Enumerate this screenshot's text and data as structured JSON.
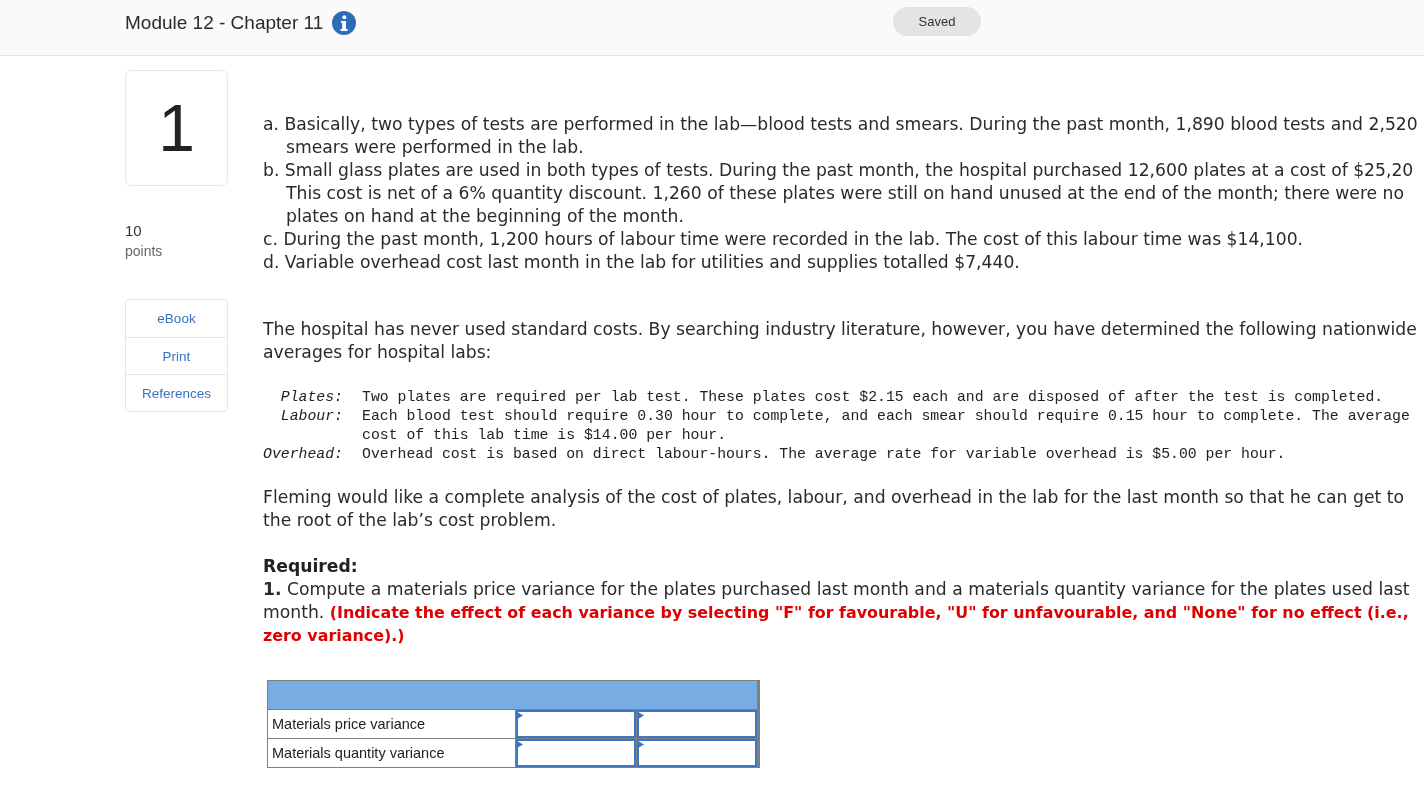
{
  "header": {
    "title": "Module 12 - Chapter 11",
    "status": "Saved"
  },
  "question": {
    "number": "1",
    "points": "10",
    "points_label": "points"
  },
  "resources": [
    {
      "label": "eBook"
    },
    {
      "label": "Print"
    },
    {
      "label": "References"
    }
  ],
  "facts": [
    "a. Basically, two types of tests are performed in the lab—blood tests and smears. During the past month, 1,890 blood tests and 2,520 smears were performed in the lab.",
    "b. Small glass plates are used in both types of tests. During the past month, the hospital purchased 12,600 plates at a cost of $25,20 This cost is net of a 6% quantity discount. 1,260 of these plates were still on hand unused at the end of the month; there were no plates on hand at the beginning of the month.",
    "c. During the past month, 1,200 hours of labour time were recorded in the lab. The cost of this labour time was $14,100.",
    "d. Variable overhead cost last month in the lab for utilities and supplies totalled $7,440."
  ],
  "intro": "The hospital has never used standard costs. By searching industry literature, however, you have determined the following nationwide averages for hospital labs:",
  "standards": [
    {
      "label": "Plates:",
      "text": "Two plates are required per lab test. These plates cost $2.15 each and are disposed of after the test is completed."
    },
    {
      "label": "Labour:",
      "text": "Each blood test should require 0.30 hour to complete, and each smear should require 0.15 hour to complete. The average cost of this lab time is $14.00 per hour."
    },
    {
      "label": "Overhead:",
      "text": "Overhead cost is based on direct labour-hours. The average rate for variable overhead is $5.00 per hour."
    }
  ],
  "analysis": "Fleming would like a complete analysis of the cost of plates, labour, and overhead in the lab for the last month so that he can get to the root of the lab’s cost problem.",
  "required": {
    "heading": "Required:",
    "number": "1.",
    "text": "Compute a materials price variance for the plates purchased last month and a materials quantity variance for the plates used last month.",
    "note": "(Indicate the effect of each variance by selecting \"F\" for favourable, \"U\" for unfavourable, and \"None\" for no effect (i.e., zero variance).)"
  },
  "table": {
    "rows": [
      {
        "label": "Materials price variance",
        "cells": [
          {
            "kind": "input"
          },
          {
            "kind": "input"
          }
        ]
      },
      {
        "label": "Materials quantity variance",
        "cells": [
          {
            "kind": "input"
          },
          {
            "kind": "input"
          }
        ]
      }
    ]
  }
}
